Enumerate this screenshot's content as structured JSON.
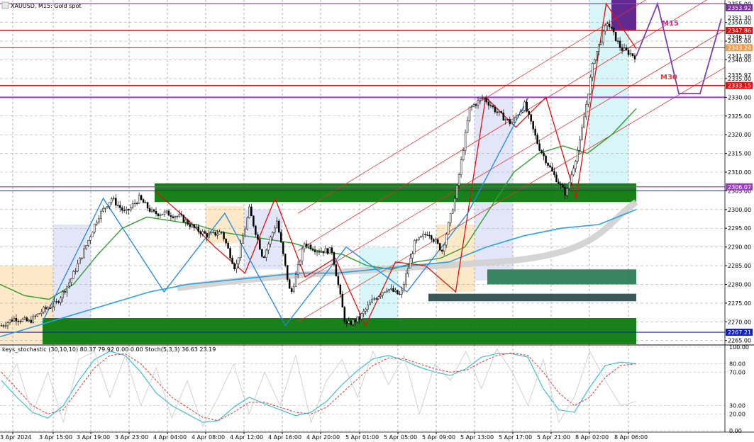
{
  "window": {
    "title": "XAUUSD, M15: Gold spot",
    "indicator_line": "keys_stochastic (30,10,10) 80.37 79.92 0.00 0.00 Stoch(5,3,3) 36.63 23.19"
  },
  "chart_data": [
    {
      "type": "candlestick",
      "title": "XAUUSD, M15: Gold spot",
      "symbol": "XAUUSD",
      "timeframe": "M15",
      "xlabel": "",
      "ylabel": "",
      "ylim": [
        2264,
        2356
      ],
      "grid": true,
      "x_ticks": [
        "3 Apr 2024",
        "3 Apr 15:00",
        "3 Apr 19:00",
        "3 Apr 23:00",
        "4 Apr 04:00",
        "4 Apr 08:00",
        "4 Apr 12:00",
        "4 Apr 16:00",
        "4 Apr 20:00",
        "5 Apr 01:00",
        "5 Apr 05:00",
        "5 Apr 09:00",
        "5 Apr 13:00",
        "5 Apr 17:00",
        "5 Apr 21:00",
        "8 Apr 02:00",
        "8 Apr 06:00"
      ],
      "y_ticks": [
        2355.0,
        2350.0,
        2345.0,
        2340.0,
        2335.0,
        2330.0,
        2325.0,
        2320.0,
        2315.0,
        2310.0,
        2305.0,
        2300.0,
        2295.0,
        2290.0,
        2285.0,
        2280.0,
        2275.0,
        2270.0,
        2265.0
      ],
      "y_ticks_text": [
        "2355.00",
        "2350.00",
        "2345.00",
        "2340.00",
        "2335.00",
        "2330.00",
        "2325.00",
        "2320.00",
        "2315.00",
        "2310.00",
        "2305.00",
        "2300.00",
        "2295.00",
        "2290.00",
        "2285.00",
        "2280.00",
        "2275.00",
        "2270.00",
        "2265.00"
      ],
      "extra_price_labels": [
        "2351.30",
        "2346.19",
        "2341.08",
        "2335.97"
      ],
      "price_tags": [
        {
          "value": 2353.92,
          "text": "2353.92",
          "color": "#7a2e9a"
        },
        {
          "value": 2347.86,
          "text": "2347.86",
          "color": "#e01010"
        },
        {
          "value": 2343.24,
          "text": "2343.24",
          "color": "#e8a050"
        },
        {
          "value": 2333.15,
          "text": "2333.15",
          "color": "#e01010"
        },
        {
          "value": 2306.07,
          "text": "2306.07",
          "color": "#9a3fc0"
        },
        {
          "value": 2267.21,
          "text": "2267.21",
          "color": "#1020c0"
        }
      ],
      "horizontal_lines": [
        {
          "value": 2355.0,
          "color": "#9a3fc0",
          "width": 1.2
        },
        {
          "value": 2347.86,
          "color": "#e01010",
          "width": 1.5
        },
        {
          "value": 2343.24,
          "color": "#e01010",
          "width": 1
        },
        {
          "value": 2333.15,
          "color": "#e01010",
          "width": 1.5
        },
        {
          "value": 2330.0,
          "color": "#9a3fc0",
          "width": 2
        },
        {
          "value": 2306.07,
          "color": "#9a3fc0",
          "width": 1.2
        },
        {
          "value": 2305.0,
          "color": "#1020c0",
          "width": 1
        },
        {
          "value": 2267.21,
          "color": "#1020c0",
          "width": 1.2
        }
      ],
      "zones": [
        {
          "from": "3 Apr 2024",
          "to": "3 Apr 15:00",
          "low": 2264,
          "high": 2285,
          "color": "#fde9c7"
        },
        {
          "from": "3 Apr 15:00",
          "to": "3 Apr 19:00",
          "low": 2264,
          "high": 2296,
          "color": "#e3e6f8"
        },
        {
          "from": "4 Apr 08:00",
          "to": "4 Apr 12:00",
          "low": 2291,
          "high": 2301,
          "color": "#fde9c7"
        },
        {
          "from": "4 Apr 12:00",
          "to": "4 Apr 16:00",
          "low": 2284,
          "high": 2300,
          "color": "#e3e6f8"
        },
        {
          "from": "5 Apr 01:00",
          "to": "5 Apr 05:00",
          "low": 2268,
          "high": 2290,
          "color": "#d8f6f8"
        },
        {
          "from": "5 Apr 09:00",
          "to": "5 Apr 13:00",
          "low": 2278,
          "high": 2296,
          "color": "#fde9c7"
        },
        {
          "from": "5 Apr 13:00",
          "to": "5 Apr 17:00",
          "low": 2281,
          "high": 2330,
          "color": "#e3e6f8"
        },
        {
          "from": "8 Apr 02:00",
          "to": "8 Apr 06:00",
          "low": 2305,
          "high": 2356,
          "color": "#d8f6f8"
        }
      ],
      "supply_demand_boxes": [
        {
          "low": 2302,
          "high": 2307,
          "color": "#0d7a0d"
        },
        {
          "low": 2264,
          "high": 2271,
          "color": "#0d7a0d"
        },
        {
          "low": 2280,
          "high": 2284,
          "color": "#2e7d57"
        },
        {
          "low": 2275.5,
          "high": 2277.5,
          "color": "#2f4f4f"
        },
        {
          "low": 2348,
          "high": 2356,
          "color": "#5a1f8a"
        }
      ],
      "annotations": [
        "M15",
        "M30"
      ],
      "series": [
        {
          "kind": "candles",
          "close_path": [
            2269,
            2271,
            2270,
            2273,
            2275,
            2281,
            2289,
            2298,
            2303,
            2299,
            2303,
            2299,
            2299,
            2298,
            2295,
            2293,
            2294,
            2284,
            2300,
            2287,
            2297,
            2277,
            2291,
            2289,
            2289,
            2269,
            2271,
            2276,
            2279,
            2277,
            2291,
            2294,
            2289,
            2304,
            2327,
            2330,
            2326,
            2323,
            2328,
            2317,
            2310,
            2304,
            2318,
            2340,
            2350,
            2343,
            2341
          ]
        },
        {
          "kind": "moving_average",
          "color": "#2ca02c",
          "values": [
            2280,
            2277,
            2276,
            2280,
            2288,
            2295,
            2298,
            2297,
            2296,
            2294,
            2293,
            2292,
            2291,
            2289,
            2288,
            2285,
            2284,
            2286,
            2287,
            2290,
            2300,
            2310,
            2315,
            2317,
            2315,
            2320,
            2327
          ]
        },
        {
          "kind": "moving_average",
          "color": "#29a3e0",
          "values": [
            2266,
            2269,
            2272,
            2275,
            2278,
            2280,
            2281,
            2282,
            2283,
            2283,
            2284,
            2285,
            2286,
            2290,
            2293,
            2295,
            2296,
            2300
          ]
        },
        {
          "kind": "zigzag_red",
          "color": "#e01010",
          "values": [
            2305,
            2298,
            2290,
            2283,
            2303,
            2282,
            2287,
            2269,
            2286,
            2285,
            2278,
            2330,
            2322,
            2330,
            2303,
            2355,
            2343
          ]
        },
        {
          "kind": "zigzag_blue",
          "color": "#1e88e5",
          "values": [
            2270,
            2303,
            2278,
            2299,
            2269,
            2290,
            2278,
            2299,
            2330
          ]
        },
        {
          "kind": "projection",
          "color": "#7a3fb8",
          "values": [
            2341,
            2355,
            2331,
            2331,
            2351
          ]
        }
      ]
    },
    {
      "type": "line",
      "title": "keys_stochastic (30,10,10) 80.37 79.92 0.00 0.00 Stoch(5,3,3) 36.63 23.19",
      "ylim": [
        0,
        100
      ],
      "y_ticks": [
        100.0,
        80.0,
        70.0,
        30.0,
        20.0,
        0.0
      ],
      "y_ticks_text": [
        "100.00",
        "80.00",
        "70.00",
        "30.00",
        "20.00",
        "0.00"
      ],
      "series": [
        {
          "name": "keys_stochastic",
          "color": "#2bbcd4",
          "values": [
            60,
            40,
            22,
            15,
            30,
            60,
            85,
            95,
            90,
            70,
            45,
            30,
            20,
            10,
            12,
            28,
            40,
            32,
            25,
            18,
            22,
            35,
            55,
            72,
            86,
            90,
            84,
            76,
            70,
            66,
            74,
            88,
            92,
            92,
            88,
            50,
            25,
            22,
            52,
            78,
            82,
            80
          ]
        },
        {
          "name": "keys_stochastic signal",
          "color": "#e04040",
          "values": [
            70,
            50,
            30,
            20,
            25,
            50,
            75,
            90,
            92,
            80,
            60,
            40,
            28,
            16,
            12,
            22,
            34,
            34,
            28,
            22,
            20,
            28,
            45,
            62,
            78,
            87,
            86,
            80,
            74,
            70,
            72,
            82,
            90,
            93,
            90,
            70,
            45,
            30,
            40,
            64,
            78,
            80
          ]
        },
        {
          "name": "Stoch(5,3,3)",
          "color": "#c8c8c8",
          "values": [
            50,
            80,
            20,
            70,
            10,
            85,
            95,
            40,
            90,
            30,
            75,
            15,
            60,
            5,
            40,
            80,
            20,
            70,
            30,
            90,
            10,
            60,
            85,
            40,
            95,
            55,
            90,
            20,
            80,
            60,
            95,
            50,
            98,
            70,
            30,
            85,
            10,
            40,
            95,
            60,
            30,
            35
          ]
        }
      ]
    }
  ]
}
